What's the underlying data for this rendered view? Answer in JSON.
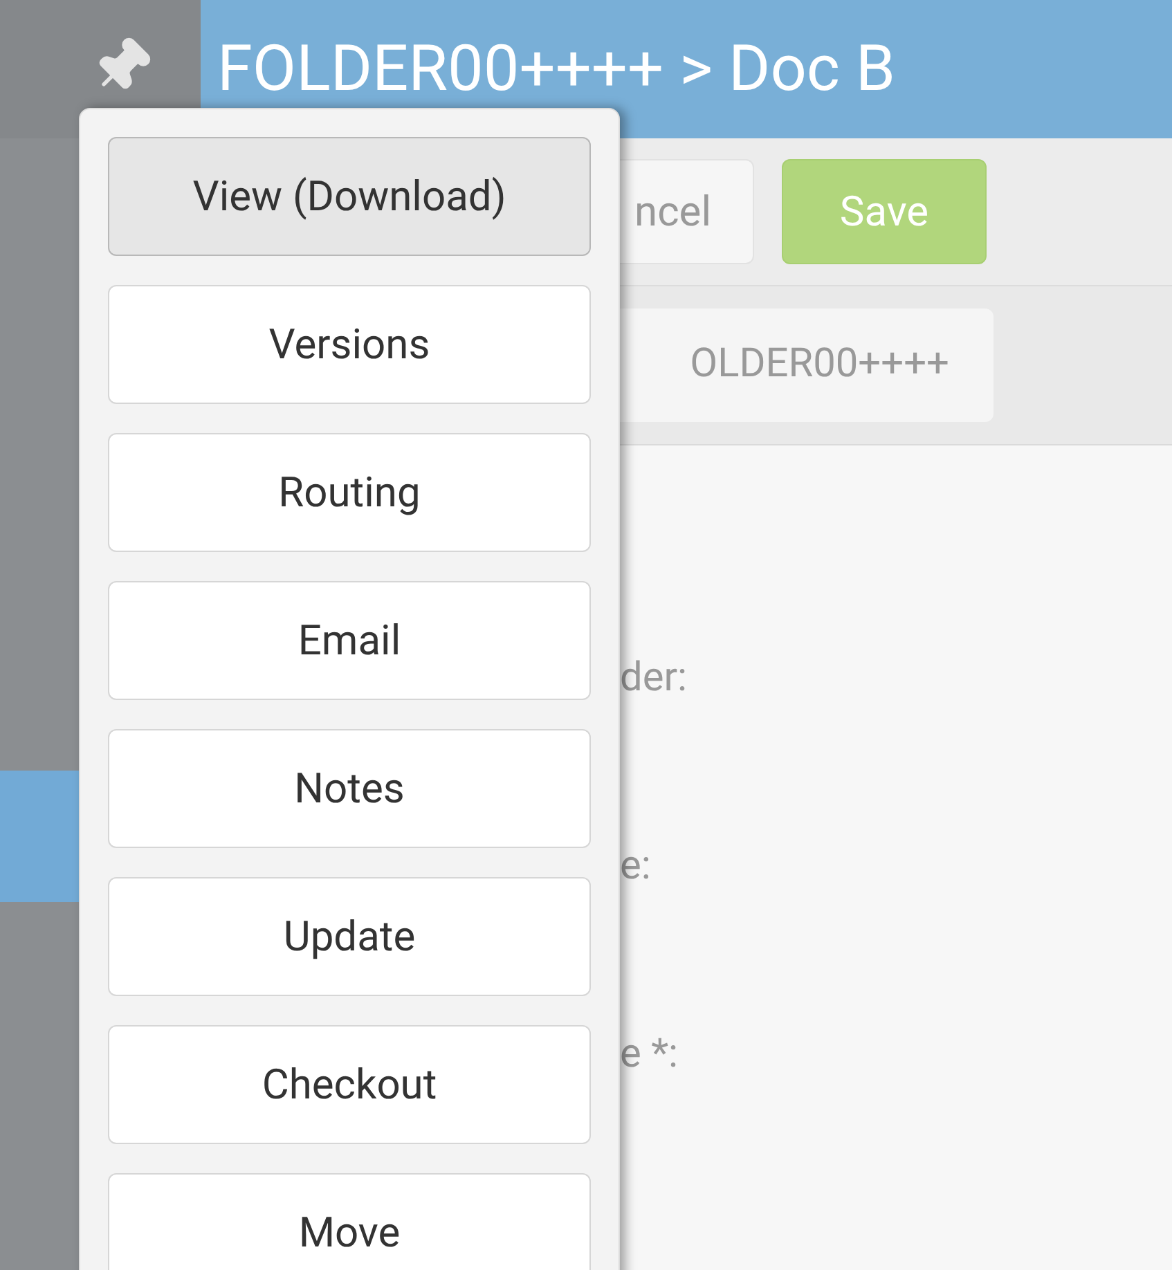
{
  "header": {
    "title": "FOLDER00++++ > Doc B"
  },
  "toolbar": {
    "buttons": [
      {
        "label": "ncel",
        "kind": "plain"
      },
      {
        "label": "Save",
        "kind": "primary"
      }
    ]
  },
  "breadcrumb": {
    "chip": "OLDER00++++"
  },
  "form": {
    "labels": [
      "der:",
      "e:",
      "e *:"
    ]
  },
  "menu": {
    "items": [
      {
        "label": "View (Download)",
        "selected": true
      },
      {
        "label": "Versions",
        "selected": false
      },
      {
        "label": "Routing",
        "selected": false
      },
      {
        "label": "Email",
        "selected": false
      },
      {
        "label": "Notes",
        "selected": false
      },
      {
        "label": "Update",
        "selected": false
      },
      {
        "label": "Checkout",
        "selected": false
      },
      {
        "label": "Move",
        "selected": false
      }
    ]
  }
}
